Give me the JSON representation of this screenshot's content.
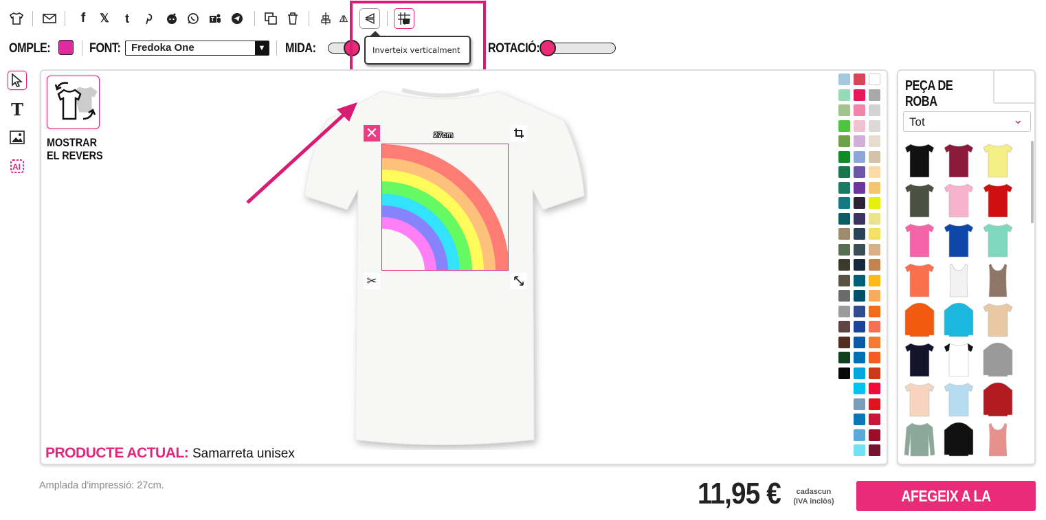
{
  "toolbar": {
    "tooltip": "Inverteix verticalment"
  },
  "options": {
    "fill_label": "OMPLE:",
    "fill_color": "#e02aa0",
    "font_label": "FONT:",
    "font_value": "Fredoka One",
    "size_label": "MIDA:",
    "rotation_label": "ROTACIÓ:",
    "size_value": 0.05,
    "rotation_value": 0.0
  },
  "canvas": {
    "reverse_button_label": "MOSTRAR EL REVERS",
    "current_product_label": "PRODUCTE ACTUAL:",
    "current_product_value": "Samarreta unisex",
    "design_width": "27cm",
    "palette": [
      "#a5c9dc",
      "#d6475a",
      "#ffffff",
      "#96dbb8",
      "#e8165a",
      "#a8a8a8",
      "#a3c38d",
      "#ef86aa",
      "#d2d2d2",
      "#4ec43f",
      "#efc2d2",
      "#dcd9d6",
      "#6ea14a",
      "#cfb0d9",
      "#e6ddd0",
      "#0d8b24",
      "#8ea5d8",
      "#d4c3aa",
      "#17774a",
      "#6b56a7",
      "#fbdaa8",
      "#1c7a64",
      "#6a379c",
      "#f3c56c",
      "#137983",
      "#2c2236",
      "#e6f00f",
      "#0c5d63",
      "#3b3460",
      "#ece28a",
      "#9e8b6e",
      "#2b4455",
      "#f2e06a",
      "#5a6e52",
      "#3d4f56",
      "#d5b089",
      "#3d3a2d",
      "#18283c",
      "#c4834e",
      "#5a5245",
      "#015e77",
      "#fdb81a",
      "#6b6b6b",
      "#00506b",
      "#f5ac5f",
      "#9b9b9b",
      "#314b8d",
      "#f06c1b",
      "#5e4344",
      "#1b4399",
      "#f47057",
      "#532d21",
      "#0c5aa4",
      "#f57933",
      "#0f3f1f",
      "#0070b5",
      "#f45c26",
      "#080808",
      "#00a6dc",
      "#cc3a18",
      null,
      "#00c2ee",
      "#ef0b3b",
      null,
      "#7d9cb8",
      "#e0121e",
      null,
      "#0a76b6",
      "#c8153c",
      null,
      "#5aaad9",
      "#9a0e2b",
      null,
      "#72e1f5",
      "#74142e"
    ]
  },
  "panel": {
    "tab_label": "PEÇA DE ROBA",
    "filter_value": "Tot",
    "products": [
      {
        "name": "tshirt-black",
        "color": "#111111",
        "type": "tee"
      },
      {
        "name": "tshirt-burgundy",
        "color": "#8b1a3b",
        "type": "tee"
      },
      {
        "name": "tshirt-yellow",
        "color": "#f5ee84",
        "type": "tee"
      },
      {
        "name": "tshirt-olive",
        "color": "#4a5140",
        "type": "tee"
      },
      {
        "name": "tshirt-pink",
        "color": "#f6b2cb",
        "type": "tee"
      },
      {
        "name": "tshirt-red",
        "color": "#d01010",
        "type": "tee"
      },
      {
        "name": "tshirt-women-pink",
        "color": "#f564a7",
        "type": "tee"
      },
      {
        "name": "tshirt-royal",
        "color": "#0e47a8",
        "type": "tee"
      },
      {
        "name": "tshirt-mint",
        "color": "#7ed8bd",
        "type": "tee"
      },
      {
        "name": "tshirt-coral",
        "color": "#fa6f4c",
        "type": "tee"
      },
      {
        "name": "tank-white",
        "color": "#f2f2f2",
        "type": "tank"
      },
      {
        "name": "tank-brown",
        "color": "#8d7666",
        "type": "tank"
      },
      {
        "name": "hoodie-orange",
        "color": "#f25a10",
        "type": "hoodie"
      },
      {
        "name": "hoodie-cyan",
        "color": "#1bb7dc",
        "type": "hoodie"
      },
      {
        "name": "tshirt-tiedye",
        "color": "#e8c9a3",
        "type": "tee"
      },
      {
        "name": "tshirt-navy",
        "color": "#14142c",
        "type": "tee"
      },
      {
        "name": "raglan-white-black",
        "color": "#ffffff",
        "type": "raglan"
      },
      {
        "name": "hoodie-grey",
        "color": "#9a9a9a",
        "type": "hoodie"
      },
      {
        "name": "tshirt-peach",
        "color": "#f7d4bd",
        "type": "tee"
      },
      {
        "name": "tshirt-gradient-blue",
        "color": "#b6dcf2",
        "type": "tee"
      },
      {
        "name": "jacket-red",
        "color": "#b31b22",
        "type": "hoodie"
      },
      {
        "name": "longsleeve-sage",
        "color": "#8ca89b",
        "type": "long"
      },
      {
        "name": "hoodie-black-orange",
        "color": "#111111",
        "type": "hoodie"
      },
      {
        "name": "tank-salmon",
        "color": "#e6918b",
        "type": "tank"
      }
    ]
  },
  "footer": {
    "print_width": "Amplada d'impressió: 27cm.",
    "price": "11,95 €",
    "price_note_1": "cadascun",
    "price_note_2": "(IVA inclòs)",
    "cart_button": "AFEGEIX A LA CISTELLA"
  }
}
